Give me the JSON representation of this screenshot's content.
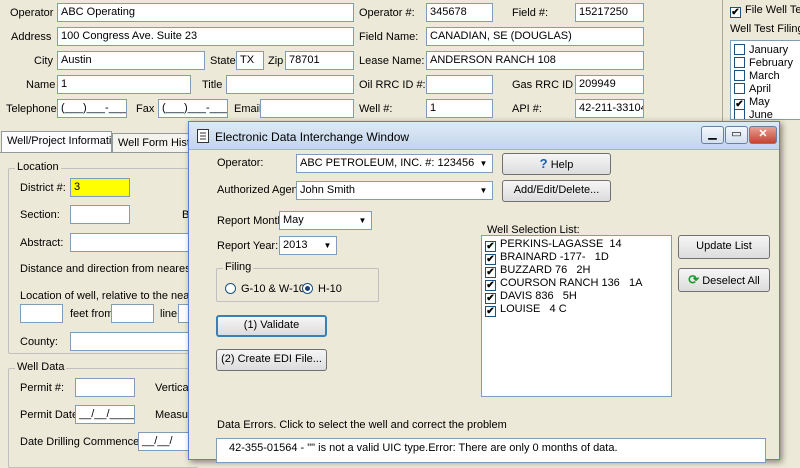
{
  "form": {
    "operator_label": "Operator",
    "operator_value": "ABC Operating",
    "address_label": "Address",
    "address_value": "100 Congress Ave.  Suite 23",
    "city_label": "City",
    "city_value": "Austin",
    "state_label": "State",
    "state_value": "TX",
    "zip_label": "Zip",
    "zip_value": "78701",
    "name_label": "Name",
    "name_value": "1",
    "title_label": "Title",
    "title_value": "",
    "telephone_label": "Telephone",
    "telephone_value": "(___)___-____",
    "fax_label": "Fax",
    "fax_value": "(___)___-____",
    "email_label": "Email:",
    "operator_num_label": "Operator #:",
    "operator_num_value": "345678",
    "field_num_label": "Field #:",
    "field_num_value": "15217250",
    "field_name_label": "Field Name:",
    "field_name_value": "CANADIAN, SE (DOUGLAS)",
    "lease_name_label": "Lease Name:",
    "lease_name_value": "ANDERSON RANCH 108",
    "oil_rrc_label": "Oil RRC ID #:",
    "oil_rrc_value": "",
    "gas_rrc_label": "Gas RRC ID #:",
    "gas_rrc_value": "209949",
    "well_num_label": "Well #:",
    "well_num_value": "1",
    "api_label": "API #:",
    "api_value": "42-211-33104"
  },
  "right_panel": {
    "file_well_test_label": "File Well Test",
    "well_test_filing_label": "Well Test Filing M",
    "months": [
      {
        "label": "January",
        "checked": false
      },
      {
        "label": "February",
        "checked": false
      },
      {
        "label": "March",
        "checked": false
      },
      {
        "label": "April",
        "checked": false
      },
      {
        "label": "May",
        "checked": true
      },
      {
        "label": "June",
        "checked": false
      }
    ]
  },
  "tabs": [
    {
      "label": "Well/Project Information",
      "active": true
    },
    {
      "label": "Well Form Histor",
      "active": false
    }
  ],
  "location": {
    "group_title": "Location",
    "district_label": "District #:",
    "district_value": "3",
    "section_label": "Section:",
    "b_label": "B",
    "abstract_label": "Abstract:",
    "distance_label": "Distance and direction from nearest to",
    "location_label": "Location of well, relative to the neares",
    "feet_from_label": "feet from",
    "line_label": "line",
    "county_label": "County:"
  },
  "well_data": {
    "group_title": "Well Data",
    "permit_num_label": "Permit #:",
    "vertical_label": "Vertica",
    "permit_date_label": "Permit Date:",
    "permit_date_value": "__/__/____",
    "measured_label": "Measu",
    "date_drilling_label": "Date Drilling Commenced:",
    "date_drilling_value": "__/__/"
  },
  "edi": {
    "title": "Electronic Data Interchange Window",
    "operator_label": "Operator:",
    "operator_value": "ABC PETROLEUM, INC.  #: 123456",
    "help_label": "Help",
    "agent_label": "Authorized Agent:",
    "agent_value": "John Smith",
    "add_edit_label": "Add/Edit/Delete...",
    "report_month_label": "Report Month:",
    "report_month_value": "May",
    "report_year_label": "Report Year:",
    "report_year_value": "2013",
    "filing_title": "Filing",
    "filing_options": [
      "G-10 & W-10",
      "H-10"
    ],
    "filing_selected": "H-10",
    "validate_label": "(1)   Validate",
    "create_edi_label": "(2)  Create EDI File...",
    "well_selection_label": "Well Selection List:",
    "wells": [
      "PERKINS-LAGASSE  14",
      "BRAINARD -177-   1D",
      "BUZZARD 76   2H",
      "COURSON RANCH 136   1A",
      "DAVIS 836   5H",
      "LOUISE   4 C"
    ],
    "update_list_label": "Update List",
    "deselect_all_label": "Deselect All",
    "data_errors_label": "Data Errors.  Click to select the well and correct the problem",
    "error_text": "42-355-01564 - \"\" is not a valid UIC type.Error:  There are only 0 months of data."
  },
  "colors": {
    "window_bg": "#ece9d8",
    "highlight_yellow": "#ffff00",
    "title_gradient": "#c4d6ec"
  }
}
